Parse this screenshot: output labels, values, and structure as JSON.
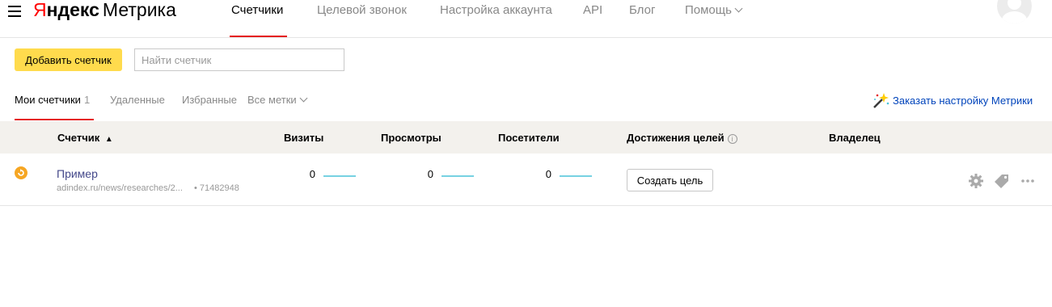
{
  "header": {
    "logo": {
      "first_letter": "Я",
      "rest": "ндекс",
      "product": "Метрика"
    },
    "nav": [
      {
        "label": "Счетчики",
        "active": true
      },
      {
        "label": "Целевой звонок",
        "active": false
      },
      {
        "label": "Настройка аккаунта",
        "active": false
      },
      {
        "label": "API",
        "active": false
      },
      {
        "label": "Блог",
        "active": false
      },
      {
        "label": "Помощь",
        "active": false,
        "has_dropdown": true
      }
    ],
    "avatar_icon": "user-avatar-icon",
    "menu_icon": "hamburger-menu-icon"
  },
  "toolbar": {
    "add_label": "Добавить счетчик",
    "search_placeholder": "Найти счетчик",
    "search_value": ""
  },
  "tabs": [
    {
      "label": "Мои счетчики",
      "count": "1",
      "active": true
    },
    {
      "label": "Удаленные",
      "active": false
    },
    {
      "label": "Избранные",
      "active": false
    },
    {
      "label": "Все метки",
      "active": false,
      "has_dropdown": true
    }
  ],
  "order_link": {
    "label": "Заказать настройку Метрики",
    "icon": "magic-wand-icon"
  },
  "table": {
    "columns": [
      "Счетчик",
      "Визиты",
      "Просмотры",
      "Посетители",
      "Достижения целей",
      "Владелец"
    ],
    "sort_indicator": "▲",
    "rows": [
      {
        "status_icon": "status-pending-icon",
        "name": "Пример",
        "url": "adindex.ru/news/researches/2...",
        "id": "• 71482948",
        "visits": "0",
        "views": "0",
        "visitors": "0",
        "goal_button": "Создать цель",
        "actions": [
          "gear-icon",
          "tag-icon",
          "more-icon"
        ]
      }
    ]
  },
  "colors": {
    "accent_red": "#e51f1f",
    "button_yellow": "#ffdb4d",
    "link_blue": "#0044bb",
    "sparkline": "#4ac4d9",
    "status_orange": "#f6a623"
  }
}
